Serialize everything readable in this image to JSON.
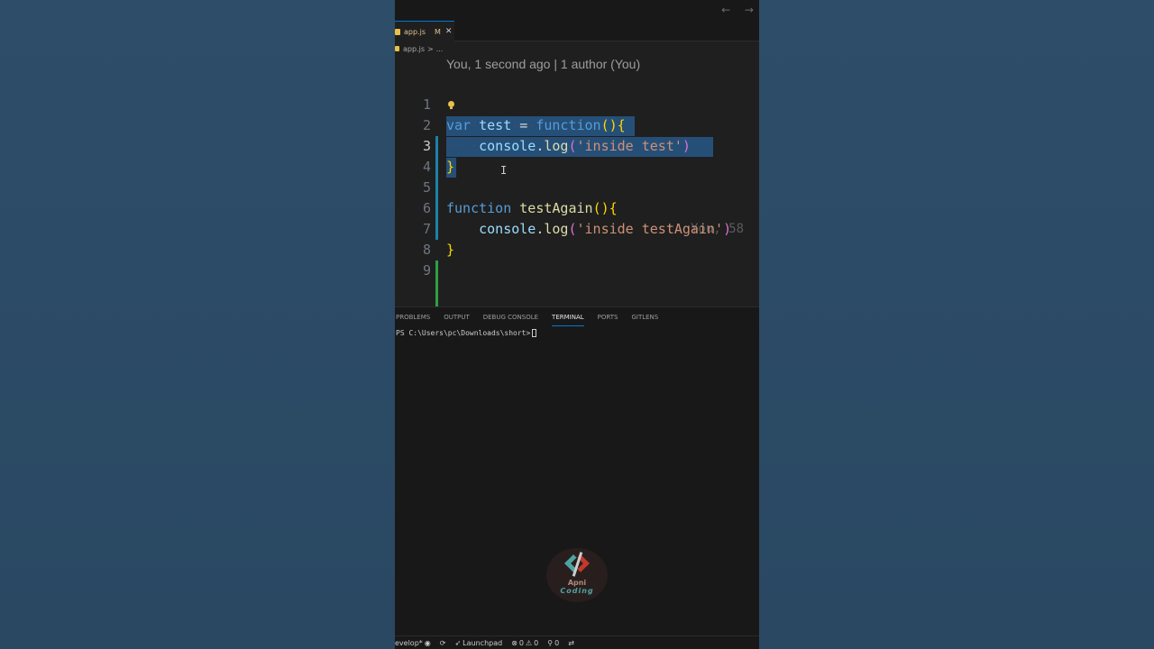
{
  "titlebar": {
    "nav_arrows": "← →"
  },
  "tab": {
    "name": "app.js",
    "modified": "M",
    "close": "✕"
  },
  "breadcrumb": {
    "file": "app.js",
    "separator": ">",
    "more": "..."
  },
  "codelens": "You, 1 second ago | 1 author (You)",
  "editor": {
    "line_numbers": [
      "1",
      "2",
      "3",
      "4",
      "5",
      "6",
      "7",
      "8",
      "9"
    ],
    "blame": "You, 58",
    "line3": {
      "kw": "var",
      "name": "test",
      "op": "=",
      "fn_kw": "function",
      "paren": "()",
      "brace": "{"
    },
    "line4": {
      "indent": "····",
      "obj": "console",
      "dot": ".",
      "method": "log",
      "open": "(",
      "str": "'inside test'",
      "close": ")"
    },
    "line5": {
      "brace": "}"
    },
    "line7": {
      "kw": "function",
      "name": "testAgain",
      "paren": "()",
      "brace": "{"
    },
    "line8": {
      "obj": "console",
      "dot": ".",
      "method": "log",
      "open": "(",
      "str": "'inside testAgain'",
      "close": ")"
    },
    "line9": {
      "brace": "}"
    },
    "cursor_glyph": "I"
  },
  "panel": {
    "tabs": [
      "PROBLEMS",
      "OUTPUT",
      "DEBUG CONSOLE",
      "TERMINAL",
      "PORTS",
      "GITLENS"
    ],
    "prompt": "PS C:\\Users\\pc\\Downloads\\short>"
  },
  "watermark": {
    "line1": "Apni",
    "line2": "Coding"
  },
  "statusbar": {
    "branch": "evelop*",
    "launchpad": "Launchpad",
    "errors": "0",
    "warnings": "0",
    "ports": "0"
  }
}
